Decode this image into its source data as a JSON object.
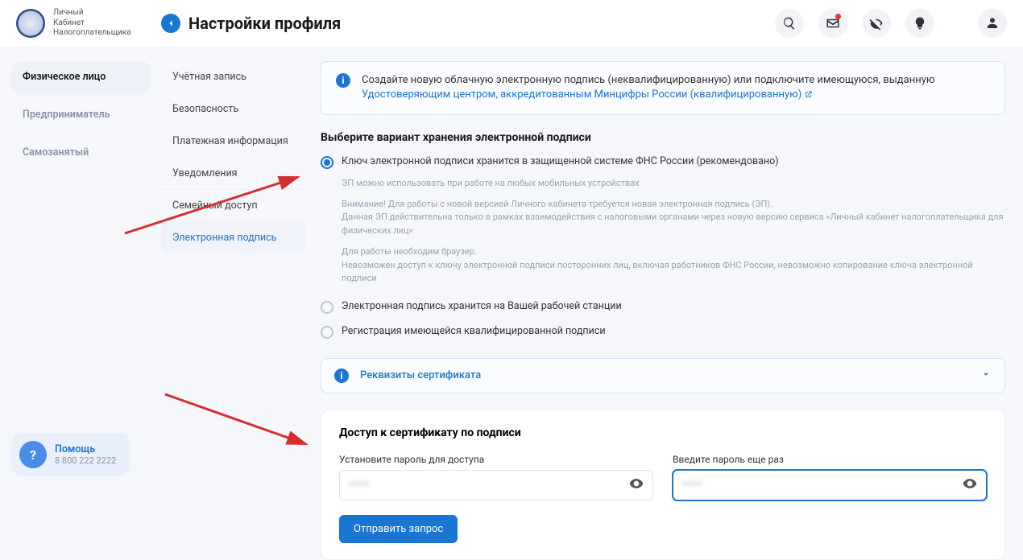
{
  "logo": {
    "l1": "Личный",
    "l2": "Кабинет",
    "l3": "Налогоплательщика"
  },
  "page_title": "Настройки профиля",
  "roles": {
    "individual": "Физическое лицо",
    "entrepreneur": "Предприниматель",
    "self_employed": "Самозанятый"
  },
  "help": {
    "title": "Помощь",
    "phone": "8 800 222 2222"
  },
  "subnav": {
    "account": "Учётная запись",
    "security": "Безопасность",
    "payment": "Платежная информация",
    "notifications": "Уведомления",
    "family": "Семейный доступ",
    "esign": "Электронная подпись"
  },
  "banner": {
    "text1": "Создайте новую облачную электронную подпись (неквалифицированную) или подключите имеющуюся, выданную",
    "link": "Удостоверяющим центром, аккредитованным Минцифры России (квалифицированную)"
  },
  "section": {
    "title": "Выберите вариант хранения электронной подписи",
    "opt1_label": "Ключ электронной подписи хранится в защищенной системе ФНС России (рекомендовано)",
    "opt1_sub": "ЭП можно использовать при работе на любых мобильных устройствах",
    "opt1_n1": "Внимание! Для работы с новой версией Личного кабинета требуется новая электронная подпись (ЭП).",
    "opt1_n2": "Данная ЭП действительна только в рамках взаимодействия с налоговыми органами через новую версию сервиса «Личный кабинет налогоплательщика для физических лиц»",
    "opt1_n3": "Для работы необходим браузер.",
    "opt1_n4": "Невозможен доступ к ключу электронной подписи посторонних лиц, включая работников ФНС России, невозможно копирование ключа электронной подписи",
    "opt2_label": "Электронная подпись хранится на Вашей рабочей станции",
    "opt3_label": "Регистрация имеющейся квалифицированной подписи"
  },
  "collapsible": {
    "title": "Реквизиты сертификата"
  },
  "access": {
    "title": "Доступ к сертификату по подписи",
    "pw1_label": "Установите пароль для доступа",
    "pw2_label": "Введите пароль еще раз",
    "submit": "Отправить запрос"
  }
}
